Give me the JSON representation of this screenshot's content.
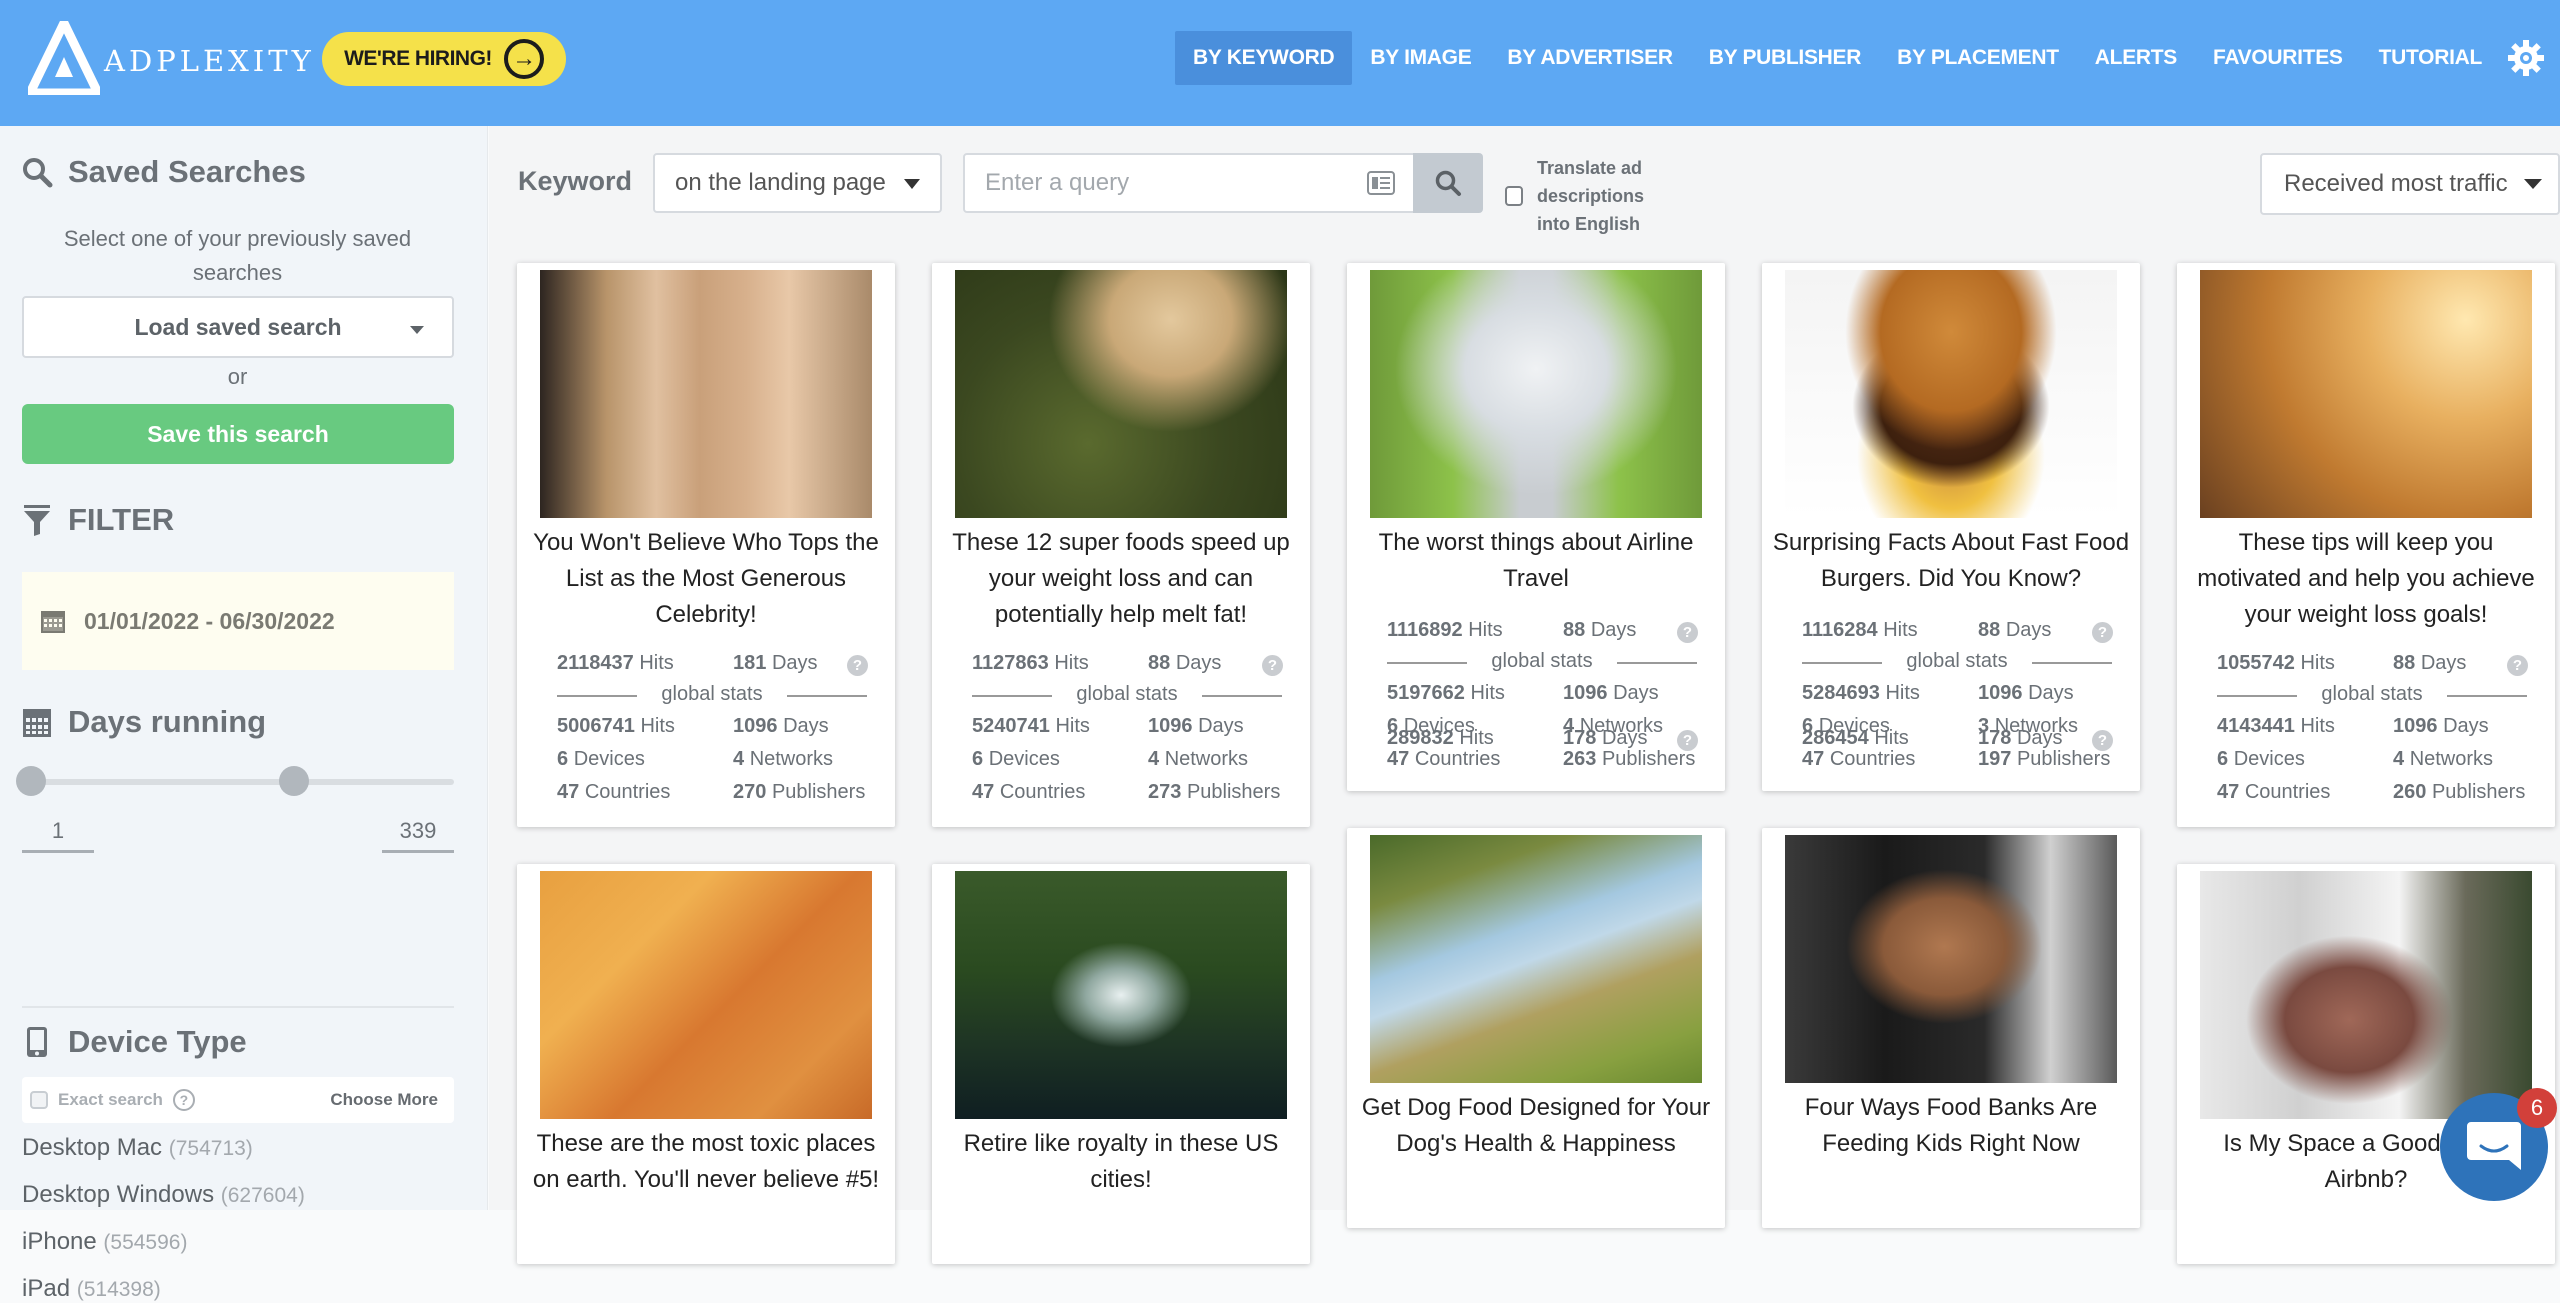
{
  "header": {
    "logo_text": "ADPLEXITY",
    "hiring_label": "WE'RE HIRING!",
    "nav": [
      {
        "label": "BY KEYWORD",
        "active": true
      },
      {
        "label": "BY IMAGE",
        "active": false
      },
      {
        "label": "BY ADVERTISER",
        "active": false
      },
      {
        "label": "BY PUBLISHER",
        "active": false
      },
      {
        "label": "BY PLACEMENT",
        "active": false
      },
      {
        "label": "ALERTS",
        "active": false
      },
      {
        "label": "FAVOURITES",
        "active": false
      },
      {
        "label": "TUTORIAL",
        "active": false
      }
    ],
    "settings_icon": "gear-icon"
  },
  "sidebar": {
    "saved_searches": {
      "title": "Saved Searches",
      "description": "Select one of your previously saved searches",
      "load_select": "Load saved search",
      "or": "or",
      "save_button": "Save this search"
    },
    "filter": {
      "title": "FILTER",
      "date_range": "01/01/2022 - 06/30/2022"
    },
    "days_running": {
      "title": "Days running",
      "min": "1",
      "max": "339",
      "slider_low_fraction": 0.0,
      "slider_high_fraction": 0.64
    },
    "device_type": {
      "title": "Device Type",
      "exact_search_label": "Exact search",
      "exact_search_checked": false,
      "help_glyph": "?",
      "choose_more": "Choose More",
      "items": [
        {
          "name": "Desktop Mac",
          "count": "(754713)"
        },
        {
          "name": "Desktop Windows",
          "count": "(627604)"
        },
        {
          "name": "iPhone",
          "count": "(554596)"
        },
        {
          "name": "iPad",
          "count": "(514398)"
        }
      ]
    }
  },
  "toolbar": {
    "keyword_label": "Keyword",
    "keyword_scope": "on the landing page",
    "query_placeholder": "Enter a query",
    "query_value": "",
    "translate_label": "Translate ad descriptions into English",
    "translate_checked": false,
    "sort": "Received most traffic"
  },
  "stat_labels": {
    "hits": "Hits",
    "days": "Days",
    "global_stats": "global stats",
    "devices": "Devices",
    "networks": "Networks",
    "countries": "Countries",
    "publishers": "Publishers",
    "help": "?"
  },
  "cards": [
    {
      "title": "You Won't Believe Who Tops the List as the Most Generous Celebrity!",
      "image": "celebrity-couple",
      "hits": "2118437",
      "days": "181",
      "g_hits": "5006741",
      "g_days": "1096",
      "devices": "6",
      "networks": "4",
      "countries": "47",
      "publishers": "270"
    },
    {
      "title": "These 12 super foods speed up your weight loss and can potentially help melt fat!",
      "image": "green-tea-leaves",
      "hits": "1127863",
      "days": "88",
      "g_hits": "5240741",
      "g_days": "1096",
      "devices": "6",
      "networks": "4",
      "countries": "47",
      "publishers": "273"
    },
    {
      "title": "The worst things about Airline Travel",
      "image": "airplane-cabin",
      "hits": "1116892",
      "days": "88",
      "g_hits": "5197662",
      "g_days": "1096",
      "devices": "6",
      "networks": "4",
      "countries": "47",
      "publishers": "263"
    },
    {
      "title": "Surprising Facts About Fast Food Burgers. Did You Know?",
      "image": "burger",
      "hits": "1116284",
      "days": "88",
      "g_hits": "5284693",
      "g_days": "1096",
      "devices": "6",
      "networks": "3",
      "countries": "47",
      "publishers": "197"
    },
    {
      "title": "These tips will keep you motivated and help you achieve your weight loss goals!",
      "image": "running-feet",
      "hits": "1055742",
      "days": "88",
      "g_hits": "4143441",
      "g_days": "1096",
      "devices": "6",
      "networks": "4",
      "countries": "47",
      "publishers": "260"
    },
    {
      "title": "These are the most toxic places on earth. You'll never believe #5!",
      "image": "toxic-river",
      "hits": null,
      "days": null
    },
    {
      "title": "Retire like royalty in these US cities!",
      "image": "waterfall-rainbow",
      "hits": null,
      "days": null
    },
    {
      "title": "Get Dog Food Designed for Your Dog's Health & Happiness",
      "image": "dog-in-field",
      "hits": "289832",
      "days": "178"
    },
    {
      "title": "Four Ways Food Banks Are Feeding Kids Right Now",
      "image": "smiling-boy",
      "hits": "286454",
      "days": "178"
    },
    {
      "title": "Is My Space a Good Fit for Airbnb?",
      "image": "woman-in-room",
      "hits": null,
      "days": null
    }
  ],
  "chat": {
    "badge_count": "6"
  }
}
